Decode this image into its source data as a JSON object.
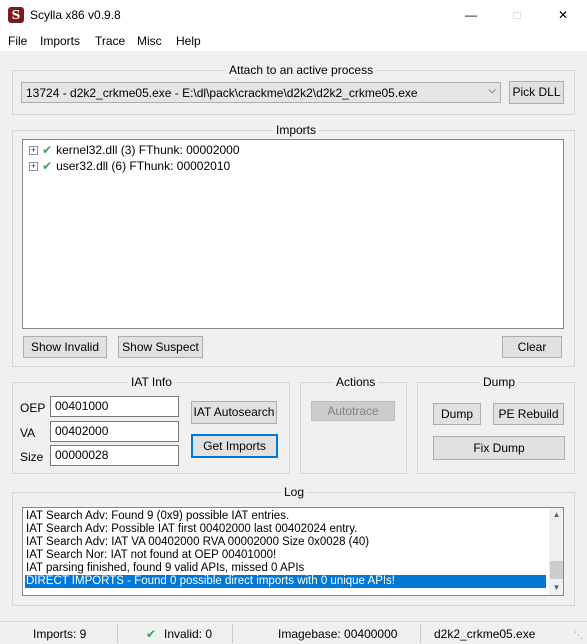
{
  "window": {
    "title": "Scylla x86 v0.9.8",
    "app_icon_glyph": "S",
    "minimize_glyph": "—",
    "maximize_glyph": "□",
    "close_glyph": "✕"
  },
  "menu": [
    "File",
    "Imports",
    "Trace",
    "Misc",
    "Help"
  ],
  "attach": {
    "title": "Attach to an active process",
    "selected_process": "13724 - d2k2_crkme05.exe - E:\\dl\\pack\\crackme\\d2k2\\d2k2_crkme05.exe",
    "pick_dll_label": "Pick DLL"
  },
  "imports": {
    "title": "Imports",
    "tree": [
      {
        "expander": "+",
        "label": "kernel32.dll (3) FThunk: 00002000"
      },
      {
        "expander": "+",
        "label": "user32.dll (6) FThunk: 00002010"
      }
    ],
    "show_invalid_label": "Show Invalid",
    "show_suspect_label": "Show Suspect",
    "clear_label": "Clear"
  },
  "iat_info": {
    "title": "IAT Info",
    "oep_label": "OEP",
    "oep_value": "00401000",
    "va_label": "VA",
    "va_value": "00402000",
    "size_label": "Size",
    "size_value": "00000028",
    "autosearch_label": "IAT Autosearch",
    "get_imports_label": "Get Imports"
  },
  "actions": {
    "title": "Actions",
    "autotrace_label": "Autotrace"
  },
  "dump": {
    "title": "Dump",
    "dump_label": "Dump",
    "pe_rebuild_label": "PE Rebuild",
    "fix_dump_label": "Fix Dump"
  },
  "log": {
    "title": "Log",
    "lines": [
      "IAT Search Adv: Found 9 (0x9) possible IAT entries.",
      "IAT Search Adv: Possible IAT first 00402000 last 00402024 entry.",
      "IAT Search Adv: IAT VA 00402000 RVA 00002000 Size 0x0028 (40)",
      "IAT Search Nor: IAT not found at OEP 00401000!",
      "IAT parsing finished, found 9 valid APIs, missed 0 APIs",
      "DIRECT IMPORTS - Found 0 possible direct imports with 0 unique APIs!"
    ],
    "selected_index": 5
  },
  "status": {
    "imports": "Imports: 9",
    "invalid": "Invalid: 0",
    "imagebase": "Imagebase: 00400000",
    "module": "d2k2_crkme05.exe"
  },
  "colors": {
    "accent": "#0078d7",
    "check": "#2fa84f",
    "app_icon_bg": "#7a1c1c"
  }
}
